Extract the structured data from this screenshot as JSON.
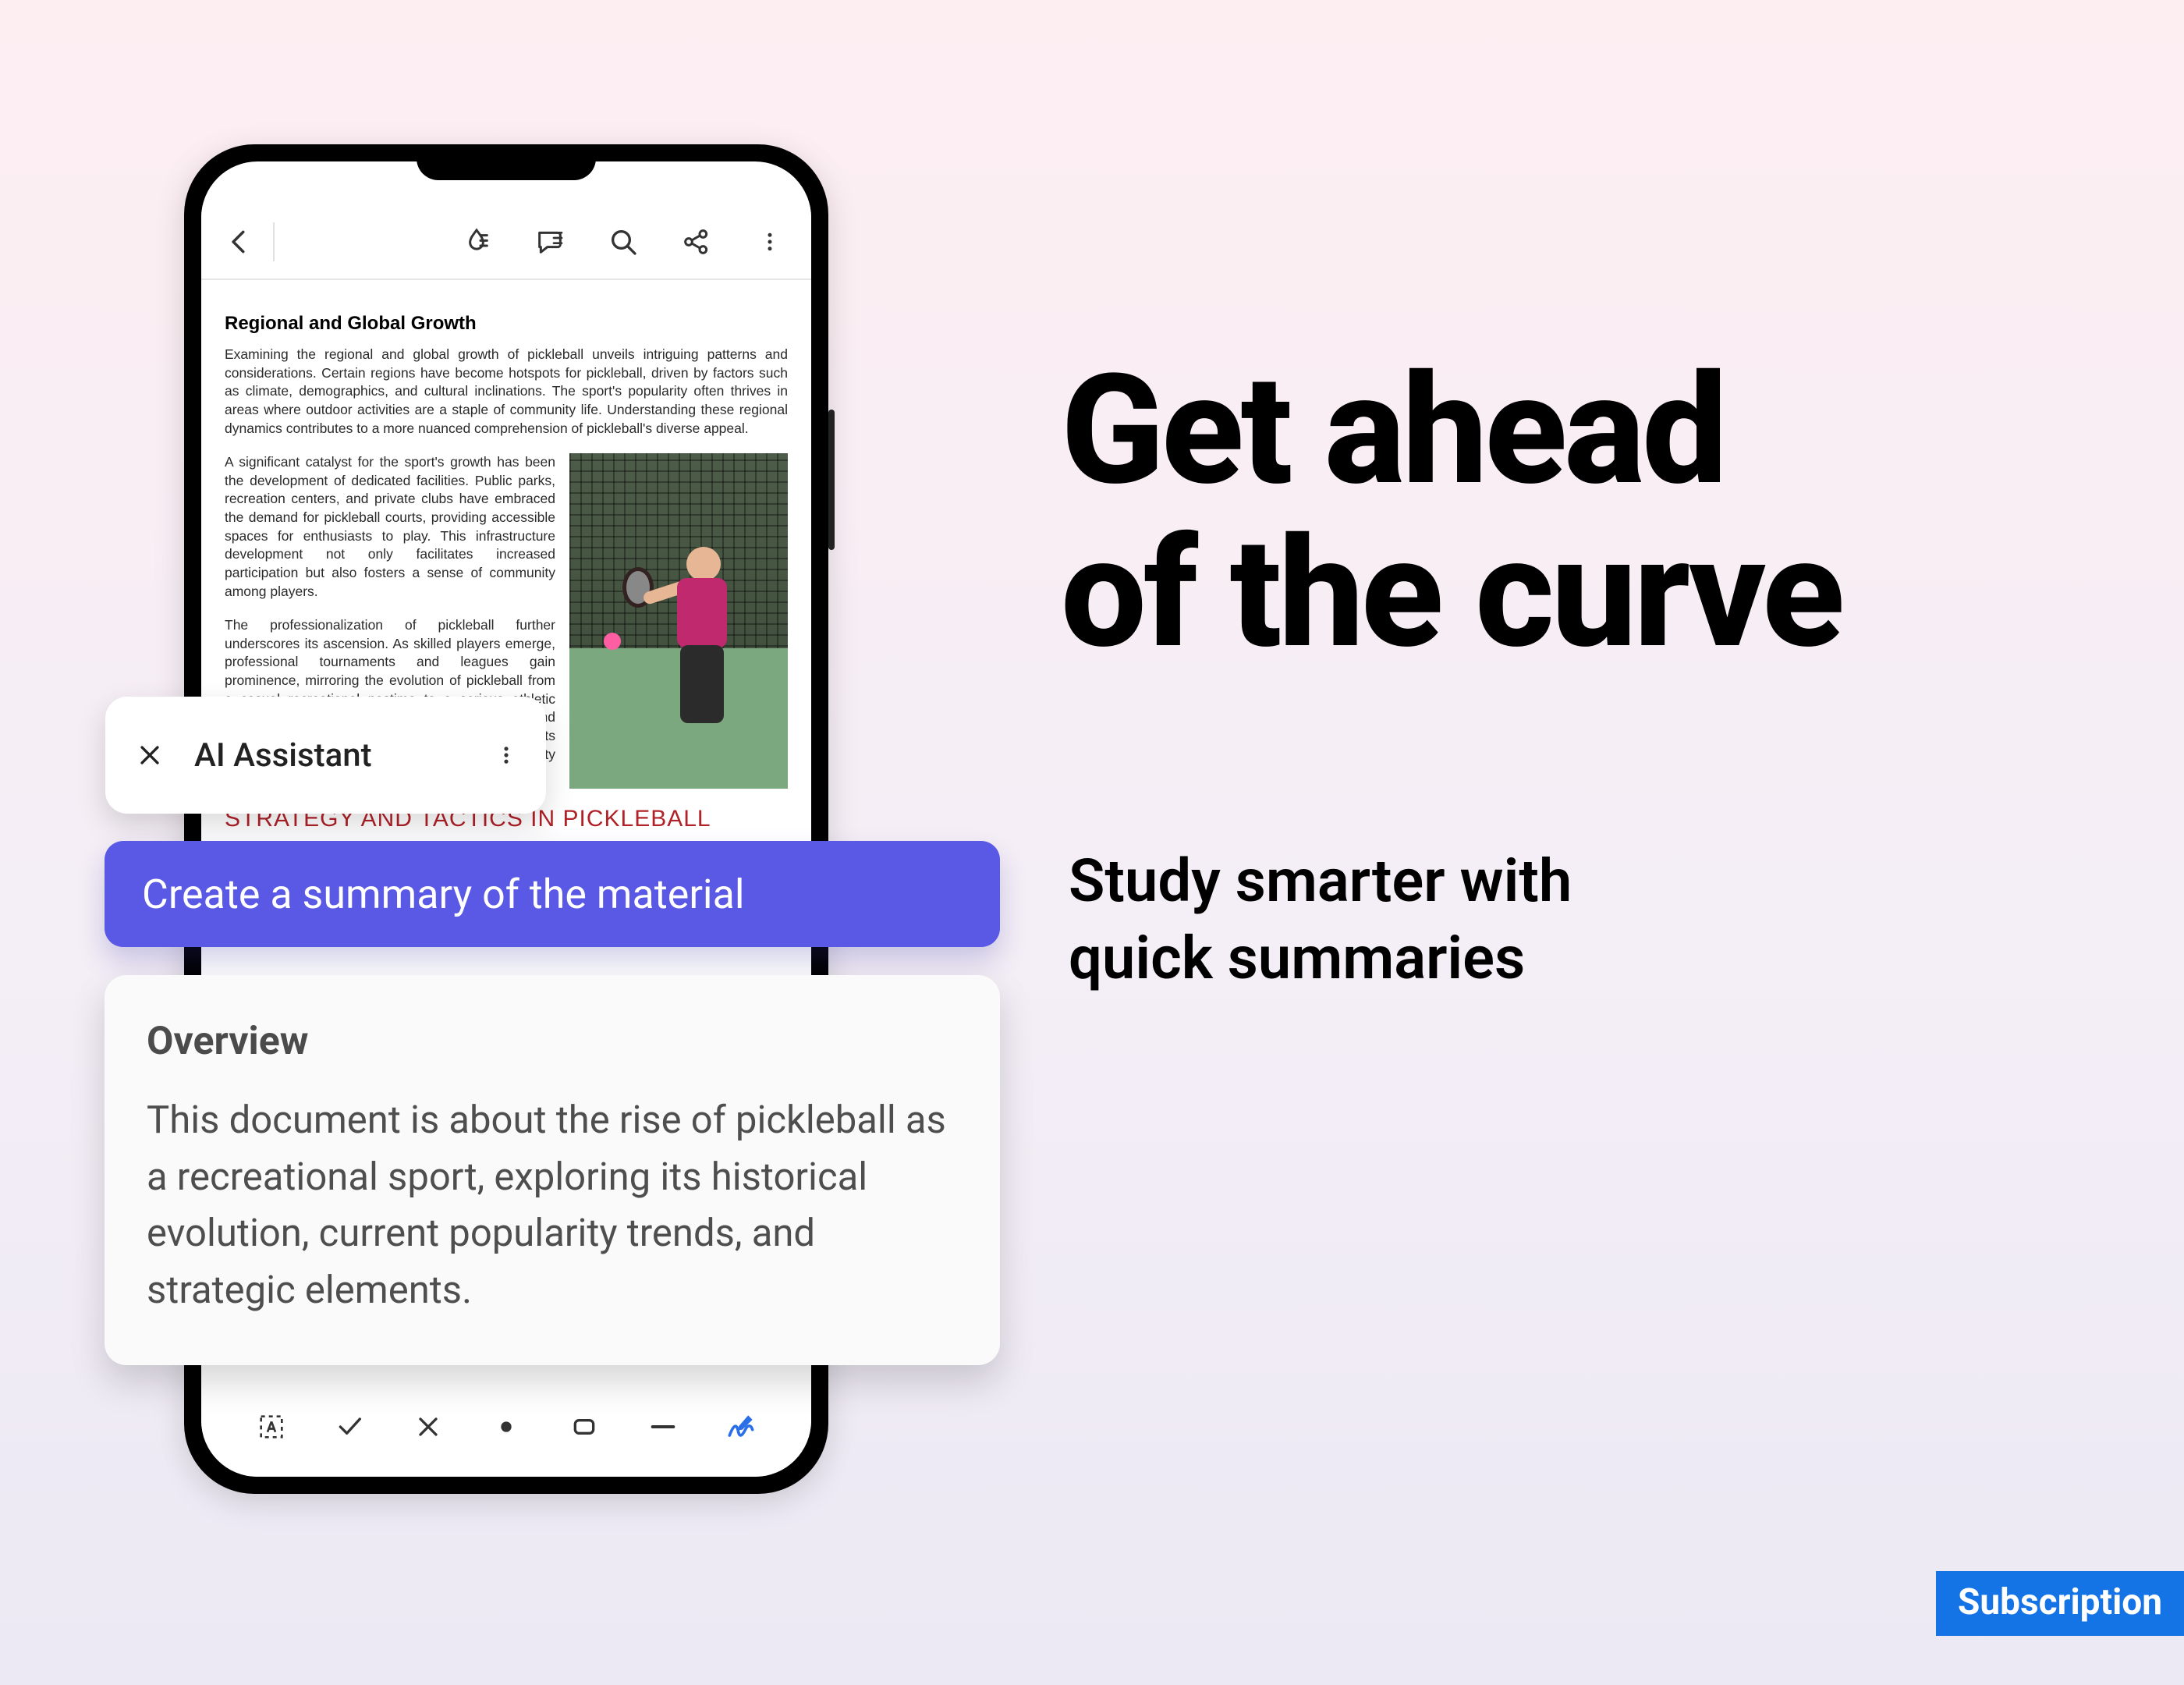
{
  "marketing": {
    "headline_line1": "Get ahead",
    "headline_line2": "of the curve",
    "sub_line1": "Study smarter with",
    "sub_line2": "quick summaries",
    "badge": "Subscription"
  },
  "ai_bar": {
    "title": "AI Assistant"
  },
  "prompt": {
    "text": "Create a summary of the material"
  },
  "overview": {
    "heading": "Overview",
    "body": "This document is about the rise of pickleball as a recreational sport, exploring its historical evolution, current popularity trends, and strategic elements."
  },
  "doc": {
    "section_title": "Regional and Global Growth",
    "p1": "Examining the regional and global growth of pickleball unveils intriguing patterns and considerations. Certain regions have become hotspots for pickleball, driven by factors such as climate, demographics, and cultural inclinations. The sport's popularity often thrives in areas where outdoor activities are a staple of community life. Understanding these regional dynamics contributes to a more nuanced comprehension of pickleball's diverse appeal.",
    "p2": "A significant catalyst for the sport's growth has been the development of dedicated facilities. Public parks, recreation centers, and private clubs have embraced the demand for pickleball courts, providing accessible spaces for enthusiasts to play. This infrastructure development not only facilitates increased participation but also fosters a sense of community among players.",
    "p3": "The professionalization of pickleball further underscores its ascension. As skilled players emerge, professional tournaments and leagues gain prominence, mirroring the evolution of pickleball from a casual recreational pastime to a serious athletic pursuit with national appeal. This paper examines and reviews the major milestones of the sport and its remarkable historical evolution, current popularity trends, and the",
    "h2": "STRATEGY AND TACTICS IN PICKLEBALL"
  },
  "icons": {
    "back": "back-icon",
    "liquid": "liquid-mode-icon",
    "comment": "comment-icon",
    "search": "search-icon",
    "share": "share-icon",
    "more": "more-icon",
    "textbox": "text-box-icon",
    "check": "check-icon",
    "x": "x-mark-icon",
    "dot": "dot-icon",
    "rect": "rect-icon",
    "dash": "dash-icon",
    "sign": "signature-icon"
  }
}
